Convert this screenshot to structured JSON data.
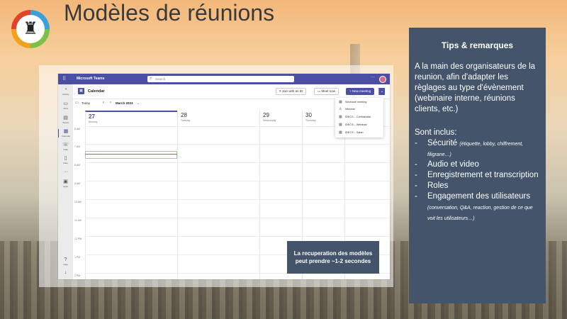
{
  "slide": {
    "title": "Modèles de réunions"
  },
  "teams": {
    "app_name": "Microsoft Teams",
    "search_placeholder": "Search",
    "rail": [
      {
        "label": "Activity",
        "icon": "bell-icon"
      },
      {
        "label": "Chat",
        "icon": "chat-icon"
      },
      {
        "label": "Teams",
        "icon": "teams-icon"
      },
      {
        "label": "Calendar",
        "icon": "calendar-icon",
        "active": true
      },
      {
        "label": "Calls",
        "icon": "phone-icon"
      },
      {
        "label": "Files",
        "icon": "file-icon"
      },
      {
        "label": "",
        "icon": "more-icon"
      },
      {
        "label": "Apps",
        "icon": "apps-icon"
      },
      {
        "label": "Help",
        "icon": "help-icon"
      },
      {
        "label": "",
        "icon": "download-icon"
      }
    ],
    "calendar": {
      "title": "Calendar",
      "join_with_id": "Join with an ID",
      "meet_now": "Meet now",
      "new_meeting": "New meeting",
      "today": "Today",
      "month": "March 2023",
      "days": [
        {
          "num": "27",
          "name": "Monday"
        },
        {
          "num": "28",
          "name": "Tuesday"
        },
        {
          "num": "29",
          "name": "Wednesday"
        },
        {
          "num": "30",
          "name": "Thursday"
        },
        {
          "num": "",
          "name": ""
        }
      ],
      "hours": [
        "6 AM",
        "7 AM",
        "8 AM",
        "9 AM",
        "10 AM",
        "11 AM",
        "12 PM",
        "1 PM",
        "2 PM"
      ]
    },
    "new_meeting_menu": [
      "Schedule meeting",
      "Webinar",
      "IDECS – Confidential",
      "IDECS – Webinair",
      "IDECS – Salon"
    ]
  },
  "toast": {
    "text": "La recuperation des modèles peut prendre ~1-2 secondes"
  },
  "tips": {
    "title": "Tips & remarques",
    "intro": "A la main des organisateurs de la reunion, afin d'adapter les règlages au type d'évènement (webinaire interne, réunions clients, etc.)",
    "included_heading": "Sont inclus:",
    "items": [
      {
        "label": "Sécurité",
        "note": "(étiquette, lobby, chiffrement, filigrane…)"
      },
      {
        "label": "Audio et video",
        "note": ""
      },
      {
        "label": "Enregistrement et transcription",
        "note": ""
      },
      {
        "label": "Roles",
        "note": ""
      },
      {
        "label": "Engagement des utilisateurs",
        "note": "(conversation, Q&A, reaction, gestion de ce que voit les utilisateurs…)"
      }
    ]
  },
  "colors": {
    "teams_purple": "#4b4fa3",
    "panel": "#44546a"
  }
}
